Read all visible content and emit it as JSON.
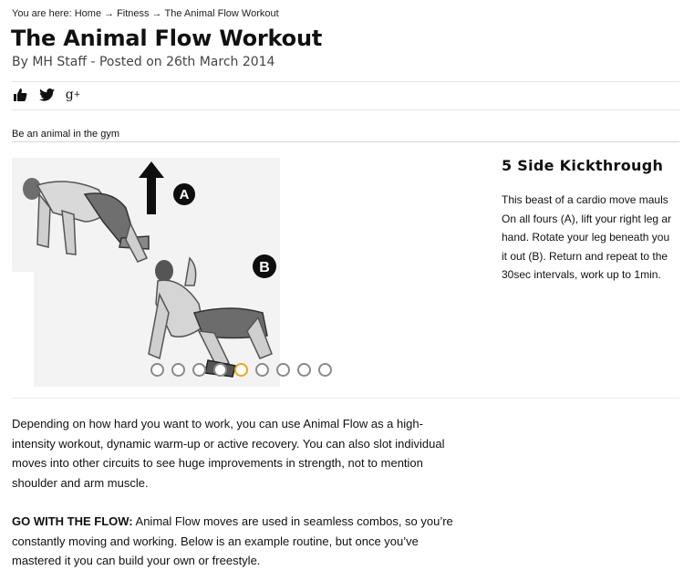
{
  "breadcrumb": {
    "prefix": "You are here:",
    "items": [
      "Home",
      "Fitness",
      "The Animal Flow Workout"
    ],
    "separator": "→"
  },
  "article": {
    "title": "The Animal Flow Workout",
    "byline": "By MH Staff - Posted on 26th March 2014",
    "tagline": "Be an animal in the gym"
  },
  "share": {
    "icons": [
      "thumbs-up-icon",
      "twitter-icon",
      "google-plus-icon"
    ],
    "google_plus_glyph": "g",
    "google_plus_sup": "+"
  },
  "gallery": {
    "label_a": "A",
    "label_b": "B",
    "slide_count": 9,
    "active_slide": 5,
    "accent": "#f0a51e"
  },
  "exercise": {
    "title": "5 Side Kickthrough",
    "lines": [
      "This beast of a cardio move mauls",
      "On all fours (A), lift your right leg ar",
      "hand. Rotate your leg beneath you",
      "it out (B). Return and repeat to the",
      "30sec intervals, work up to 1min."
    ]
  },
  "body": {
    "paragraph1": "Depending on how hard you want to work, you can use Animal Flow as a high-intensity workout, dynamic warm-up or active recovery. You can also slot individual moves into other circuits to see huge improvements in strength, not to mention shoulder and arm muscle.",
    "paragraph2_lead": "GO WITH THE FLOW:",
    "paragraph2_text": " Animal Flow moves are used in seamless combos, so you’re constantly moving and working. Below is an example routine, but once you’ve mastered it you can build your own or freestyle."
  }
}
